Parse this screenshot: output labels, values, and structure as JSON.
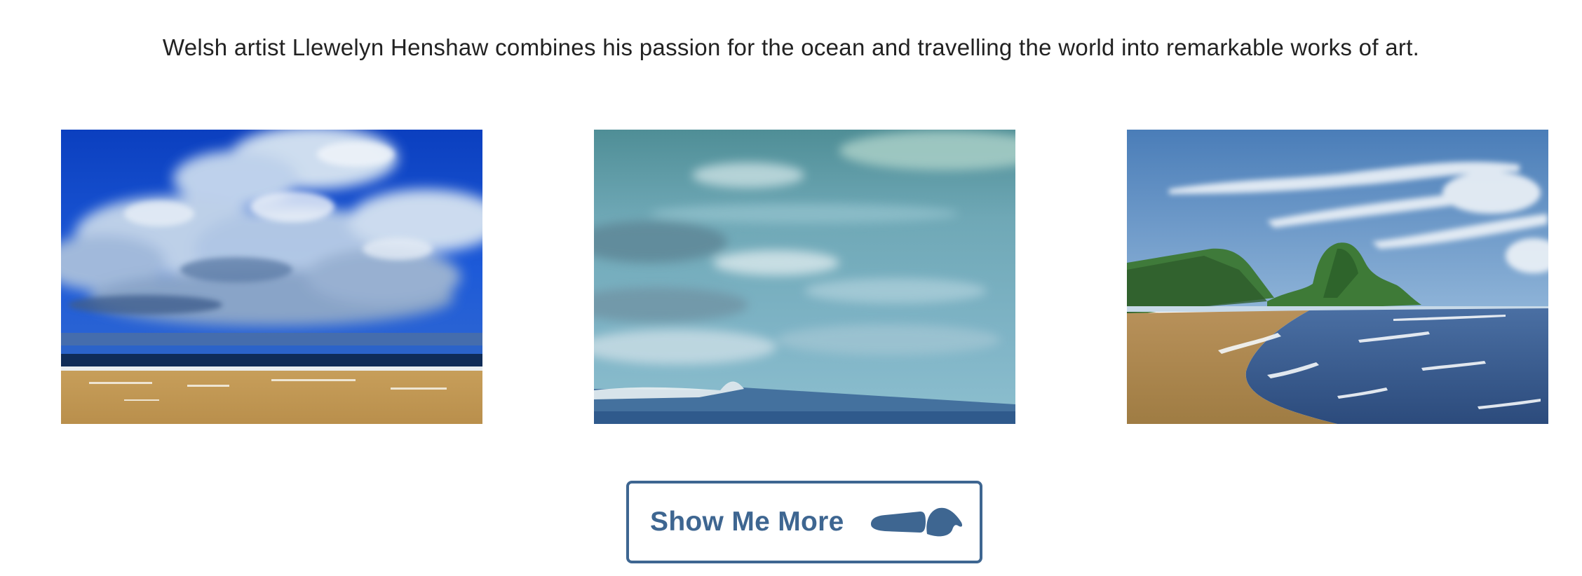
{
  "intro": {
    "text": "Welsh artist Llewelyn Henshaw combines his passion for the ocean and travelling the world into remarkable works of art."
  },
  "gallery": {
    "paintings": [
      {
        "subject": "cloudy beach seascape with deep blue sky"
      },
      {
        "subject": "teal sky seascape with breaking wave"
      },
      {
        "subject": "headland coastline with waves and sandy shore"
      }
    ]
  },
  "cta": {
    "label": "Show Me More",
    "icon": "surfboard-wave-icon",
    "color": "#3e6691"
  }
}
